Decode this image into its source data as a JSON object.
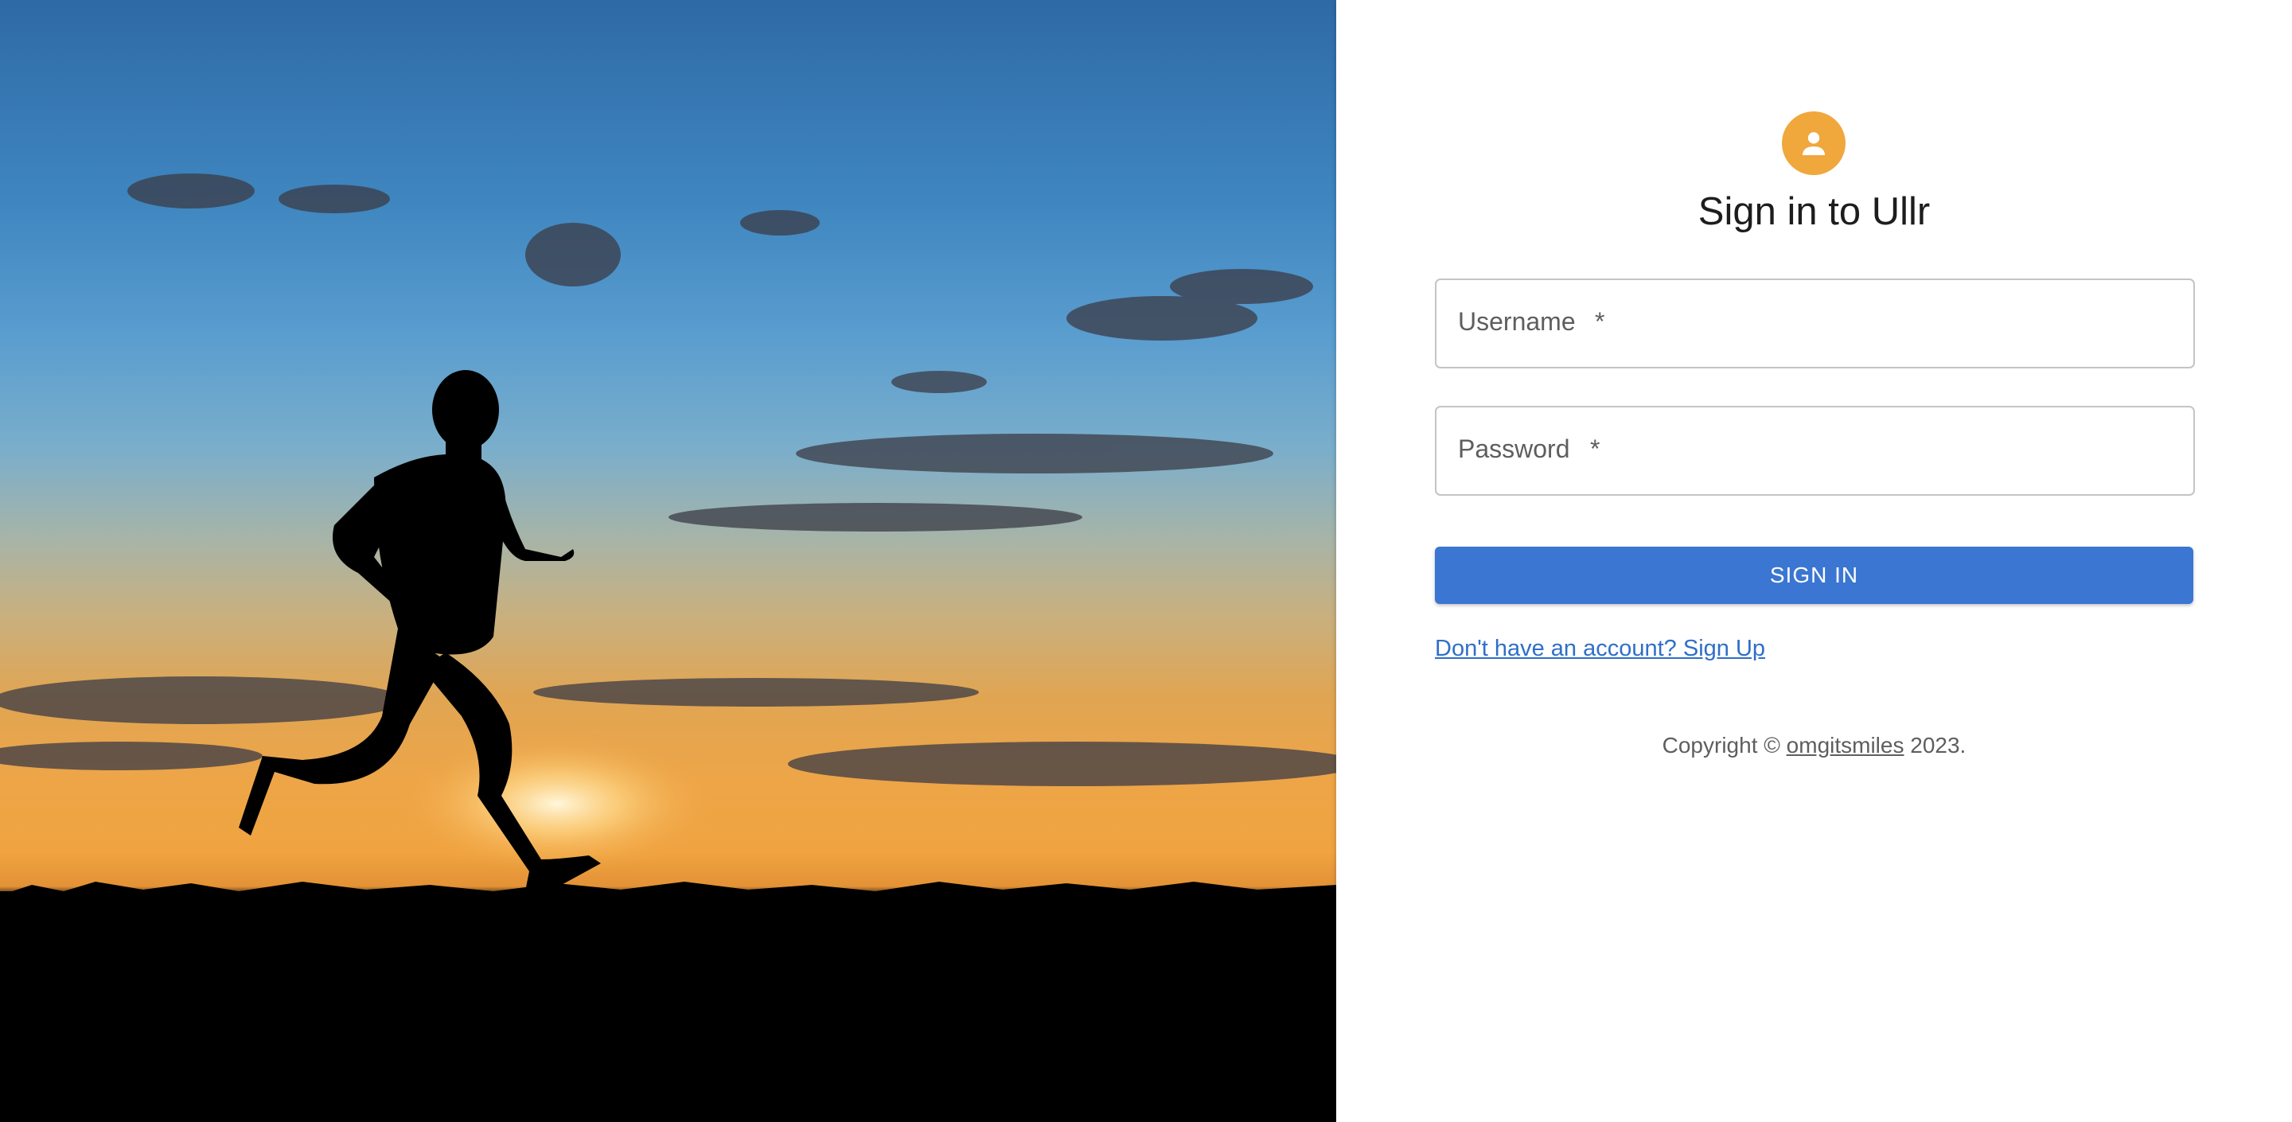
{
  "hero": {
    "icon": "runner-sunset-image"
  },
  "form": {
    "icon": "person-icon",
    "accent_color": "#f0a73c",
    "title": "Sign in to Ullr",
    "username": {
      "label": "Username",
      "required_marker": "*",
      "value": ""
    },
    "password": {
      "label": "Password",
      "required_marker": "*",
      "value": ""
    },
    "submit_label": "SIGN IN",
    "button_color": "#3a76d2",
    "signup_link": "Don't have an account? Sign Up",
    "copyright": {
      "prefix": "Copyright © ",
      "owner": "omgitsmiles",
      "suffix": " 2023."
    }
  }
}
